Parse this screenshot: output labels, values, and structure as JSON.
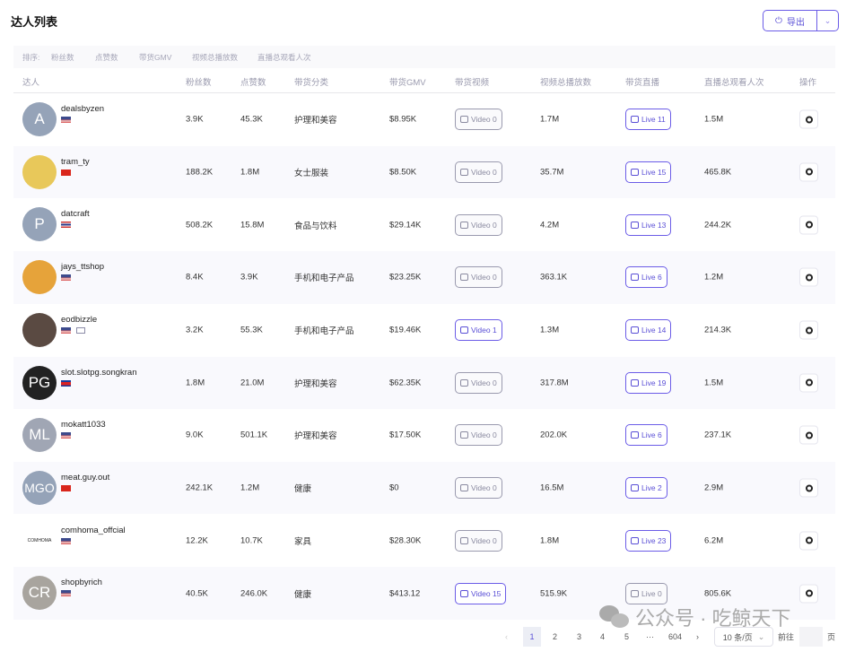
{
  "title": "达人列表",
  "export": {
    "label": "导出"
  },
  "sort": {
    "label": "排序:",
    "options": [
      "粉丝数",
      "点赞数",
      "带货GMV",
      "视频总播放数",
      "直播总观看人次"
    ]
  },
  "columns": [
    "达人",
    "粉丝数",
    "点赞数",
    "带货分类",
    "带货GMV",
    "带货视频",
    "视频总播放数",
    "带货直播",
    "直播总观看人次",
    "操作"
  ],
  "rows": [
    {
      "initials": "A",
      "avatar_color": "#95a3b8",
      "name": "dealsbyzen",
      "flag": "us",
      "followers": "3.9K",
      "likes": "45.3K",
      "category": "护理和美容",
      "gmv": "$8.95K",
      "video": "Video 0",
      "video_active": false,
      "plays": "1.7M",
      "live": "Live 11",
      "live_active": true,
      "viewers": "1.5M"
    },
    {
      "initials": "",
      "avatar_color": "#e8c85a",
      "name": "tram_ty",
      "flag": "vn",
      "followers": "188.2K",
      "likes": "1.8M",
      "category": "女士服装",
      "gmv": "$8.50K",
      "video": "Video 0",
      "video_active": false,
      "plays": "35.7M",
      "live": "Live 15",
      "live_active": true,
      "viewers": "465.8K"
    },
    {
      "initials": "P",
      "avatar_color": "#95a3b8",
      "name": "datcraft",
      "flag": "th",
      "followers": "508.2K",
      "likes": "15.8M",
      "category": "食品与饮料",
      "gmv": "$29.14K",
      "video": "Video 0",
      "video_active": false,
      "plays": "4.2M",
      "live": "Live 13",
      "live_active": true,
      "viewers": "244.2K"
    },
    {
      "initials": "",
      "avatar_color": "#e6a33a",
      "name": "jays_ttshop",
      "flag": "us",
      "followers": "8.4K",
      "likes": "3.9K",
      "category": "手机和电子产品",
      "gmv": "$23.25K",
      "video": "Video 0",
      "video_active": false,
      "plays": "363.1K",
      "live": "Live 6",
      "live_active": true,
      "viewers": "1.2M"
    },
    {
      "initials": "",
      "avatar_color": "#5a4a42",
      "name": "eodbizzle",
      "flag": "us",
      "mail": true,
      "followers": "3.2K",
      "likes": "55.3K",
      "category": "手机和电子产品",
      "gmv": "$19.46K",
      "video": "Video 1",
      "video_active": true,
      "plays": "1.3M",
      "live": "Live 14",
      "live_active": true,
      "viewers": "214.3K"
    },
    {
      "initials": "PG",
      "avatar_color": "#222222",
      "name": "slot.slotpg.songkran",
      "flag": "kh",
      "followers": "1.8M",
      "likes": "21.0M",
      "category": "护理和美容",
      "gmv": "$62.35K",
      "video": "Video 0",
      "video_active": false,
      "plays": "317.8M",
      "live": "Live 19",
      "live_active": true,
      "viewers": "1.5M"
    },
    {
      "initials": "ML",
      "avatar_color": "#a0a6b4",
      "name": "mokatt1033",
      "flag": "us",
      "followers": "9.0K",
      "likes": "501.1K",
      "category": "护理和美容",
      "gmv": "$17.50K",
      "video": "Video 0",
      "video_active": false,
      "plays": "202.0K",
      "live": "Live 6",
      "live_active": true,
      "viewers": "237.1K"
    },
    {
      "initials": "MGO",
      "avatar_color": "#95a3b8",
      "name": "meat.guy.out",
      "flag": "vn",
      "followers": "242.1K",
      "likes": "1.2M",
      "category": "健康",
      "gmv": "$0",
      "video": "Video 0",
      "video_active": false,
      "plays": "16.5M",
      "live": "Live 2",
      "live_active": true,
      "viewers": "2.9M"
    },
    {
      "initials": "COMHOMA",
      "avatar_color": "#ffffff",
      "name": "comhoma_offcial",
      "flag": "us",
      "followers": "12.2K",
      "likes": "10.7K",
      "category": "家具",
      "gmv": "$28.30K",
      "video": "Video 0",
      "video_active": false,
      "plays": "1.8M",
      "live": "Live 23",
      "live_active": true,
      "viewers": "6.2M"
    },
    {
      "initials": "CR",
      "avatar_color": "#a8a49e",
      "name": "shopbyrich",
      "flag": "us",
      "followers": "40.5K",
      "likes": "246.0K",
      "category": "健康",
      "gmv": "$413.12",
      "video": "Video 15",
      "video_active": true,
      "plays": "515.9K",
      "live": "Live 0",
      "live_active": false,
      "viewers": "805.6K"
    }
  ],
  "pagination": {
    "pages": [
      "1",
      "2",
      "3",
      "4",
      "5"
    ],
    "ellipsis": "···",
    "last": "604",
    "page_size": "10 条/页",
    "goto": "前往",
    "page_suffix": "页"
  },
  "watermark": "公众号 · 吃鲸天下"
}
